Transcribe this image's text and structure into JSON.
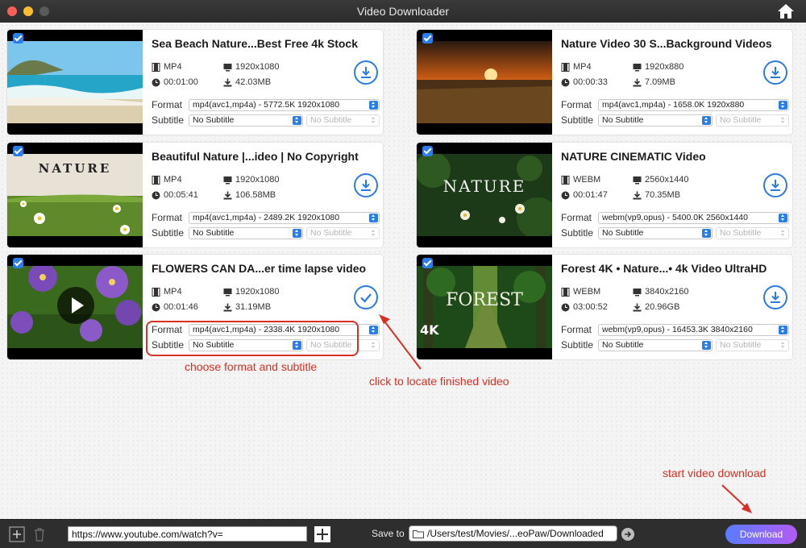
{
  "window": {
    "title": "Video Downloader"
  },
  "labels": {
    "format": "Format",
    "subtitle": "Subtitle"
  },
  "videos": [
    {
      "title": "Sea Beach Nature...Best Free 4k Stock",
      "container": "MP4",
      "resolution": "1920x1080",
      "duration": "00:01:00",
      "size": "42.03MB",
      "format": "mp4(avc1,mp4a) - 5772.5K 1920x1080",
      "subtitle": "No Subtitle",
      "subtitle_lang": "No Subtitle",
      "status": "download",
      "checked": true,
      "thumb_text": ""
    },
    {
      "title": "Nature Video 30 S...Background Videos",
      "container": "MP4",
      "resolution": "1920x880",
      "duration": "00:00:33",
      "size": "7.09MB",
      "format": "mp4(avc1,mp4a) - 1658.0K 1920x880",
      "subtitle": "No Subtitle",
      "subtitle_lang": "No Subtitle",
      "status": "download",
      "checked": true,
      "thumb_text": ""
    },
    {
      "title": "Beautiful Nature |...ideo | No Copyright",
      "container": "MP4",
      "resolution": "1920x1080",
      "duration": "00:05:41",
      "size": "106.58MB",
      "format": "mp4(avc1,mp4a) - 2489.2K 1920x1080",
      "subtitle": "No Subtitle",
      "subtitle_lang": "No Subtitle",
      "status": "download",
      "checked": true,
      "thumb_text": "NATURE"
    },
    {
      "title": "NATURE CINEMATIC Video",
      "container": "WEBM",
      "resolution": "2560x1440",
      "duration": "00:01:47",
      "size": "70.35MB",
      "format": "webm(vp9,opus) - 5400.0K 2560x1440",
      "subtitle": "No Subtitle",
      "subtitle_lang": "No Subtitle",
      "status": "download",
      "checked": true,
      "thumb_text": "NATURE"
    },
    {
      "title": "FLOWERS CAN DA...er time lapse video",
      "container": "MP4",
      "resolution": "1920x1080",
      "duration": "00:01:46",
      "size": "31.19MB",
      "format": "mp4(avc1,mp4a) - 2338.4K 1920x1080",
      "subtitle": "No Subtitle",
      "subtitle_lang": "No Subtitle",
      "status": "finished",
      "checked": true,
      "thumb_text": ""
    },
    {
      "title": "Forest 4K • Nature...• 4k Video UltraHD",
      "container": "WEBM",
      "resolution": "3840x2160",
      "duration": "03:00:52",
      "size": "20.96GB",
      "format": "webm(vp9,opus) - 16453.3K 3840x2160",
      "subtitle": "No Subtitle",
      "subtitle_lang": "No Subtitle",
      "status": "download",
      "checked": true,
      "thumb_text": "FOREST"
    }
  ],
  "annotations": {
    "choose": "choose format and subtitle",
    "locate": "click to locate finished video",
    "start": "start video download"
  },
  "bottombar": {
    "url_value": "https://www.youtube.com/watch?v=",
    "save_to_label": "Save to",
    "save_path": "/Users/test/Movies/...eoPaw/Downloaded",
    "download_label": "Download"
  },
  "colors": {
    "accent": "#2b7de9",
    "annotation": "#d93025",
    "download_gradient": [
      "#5a7bff",
      "#b25cf2"
    ]
  }
}
